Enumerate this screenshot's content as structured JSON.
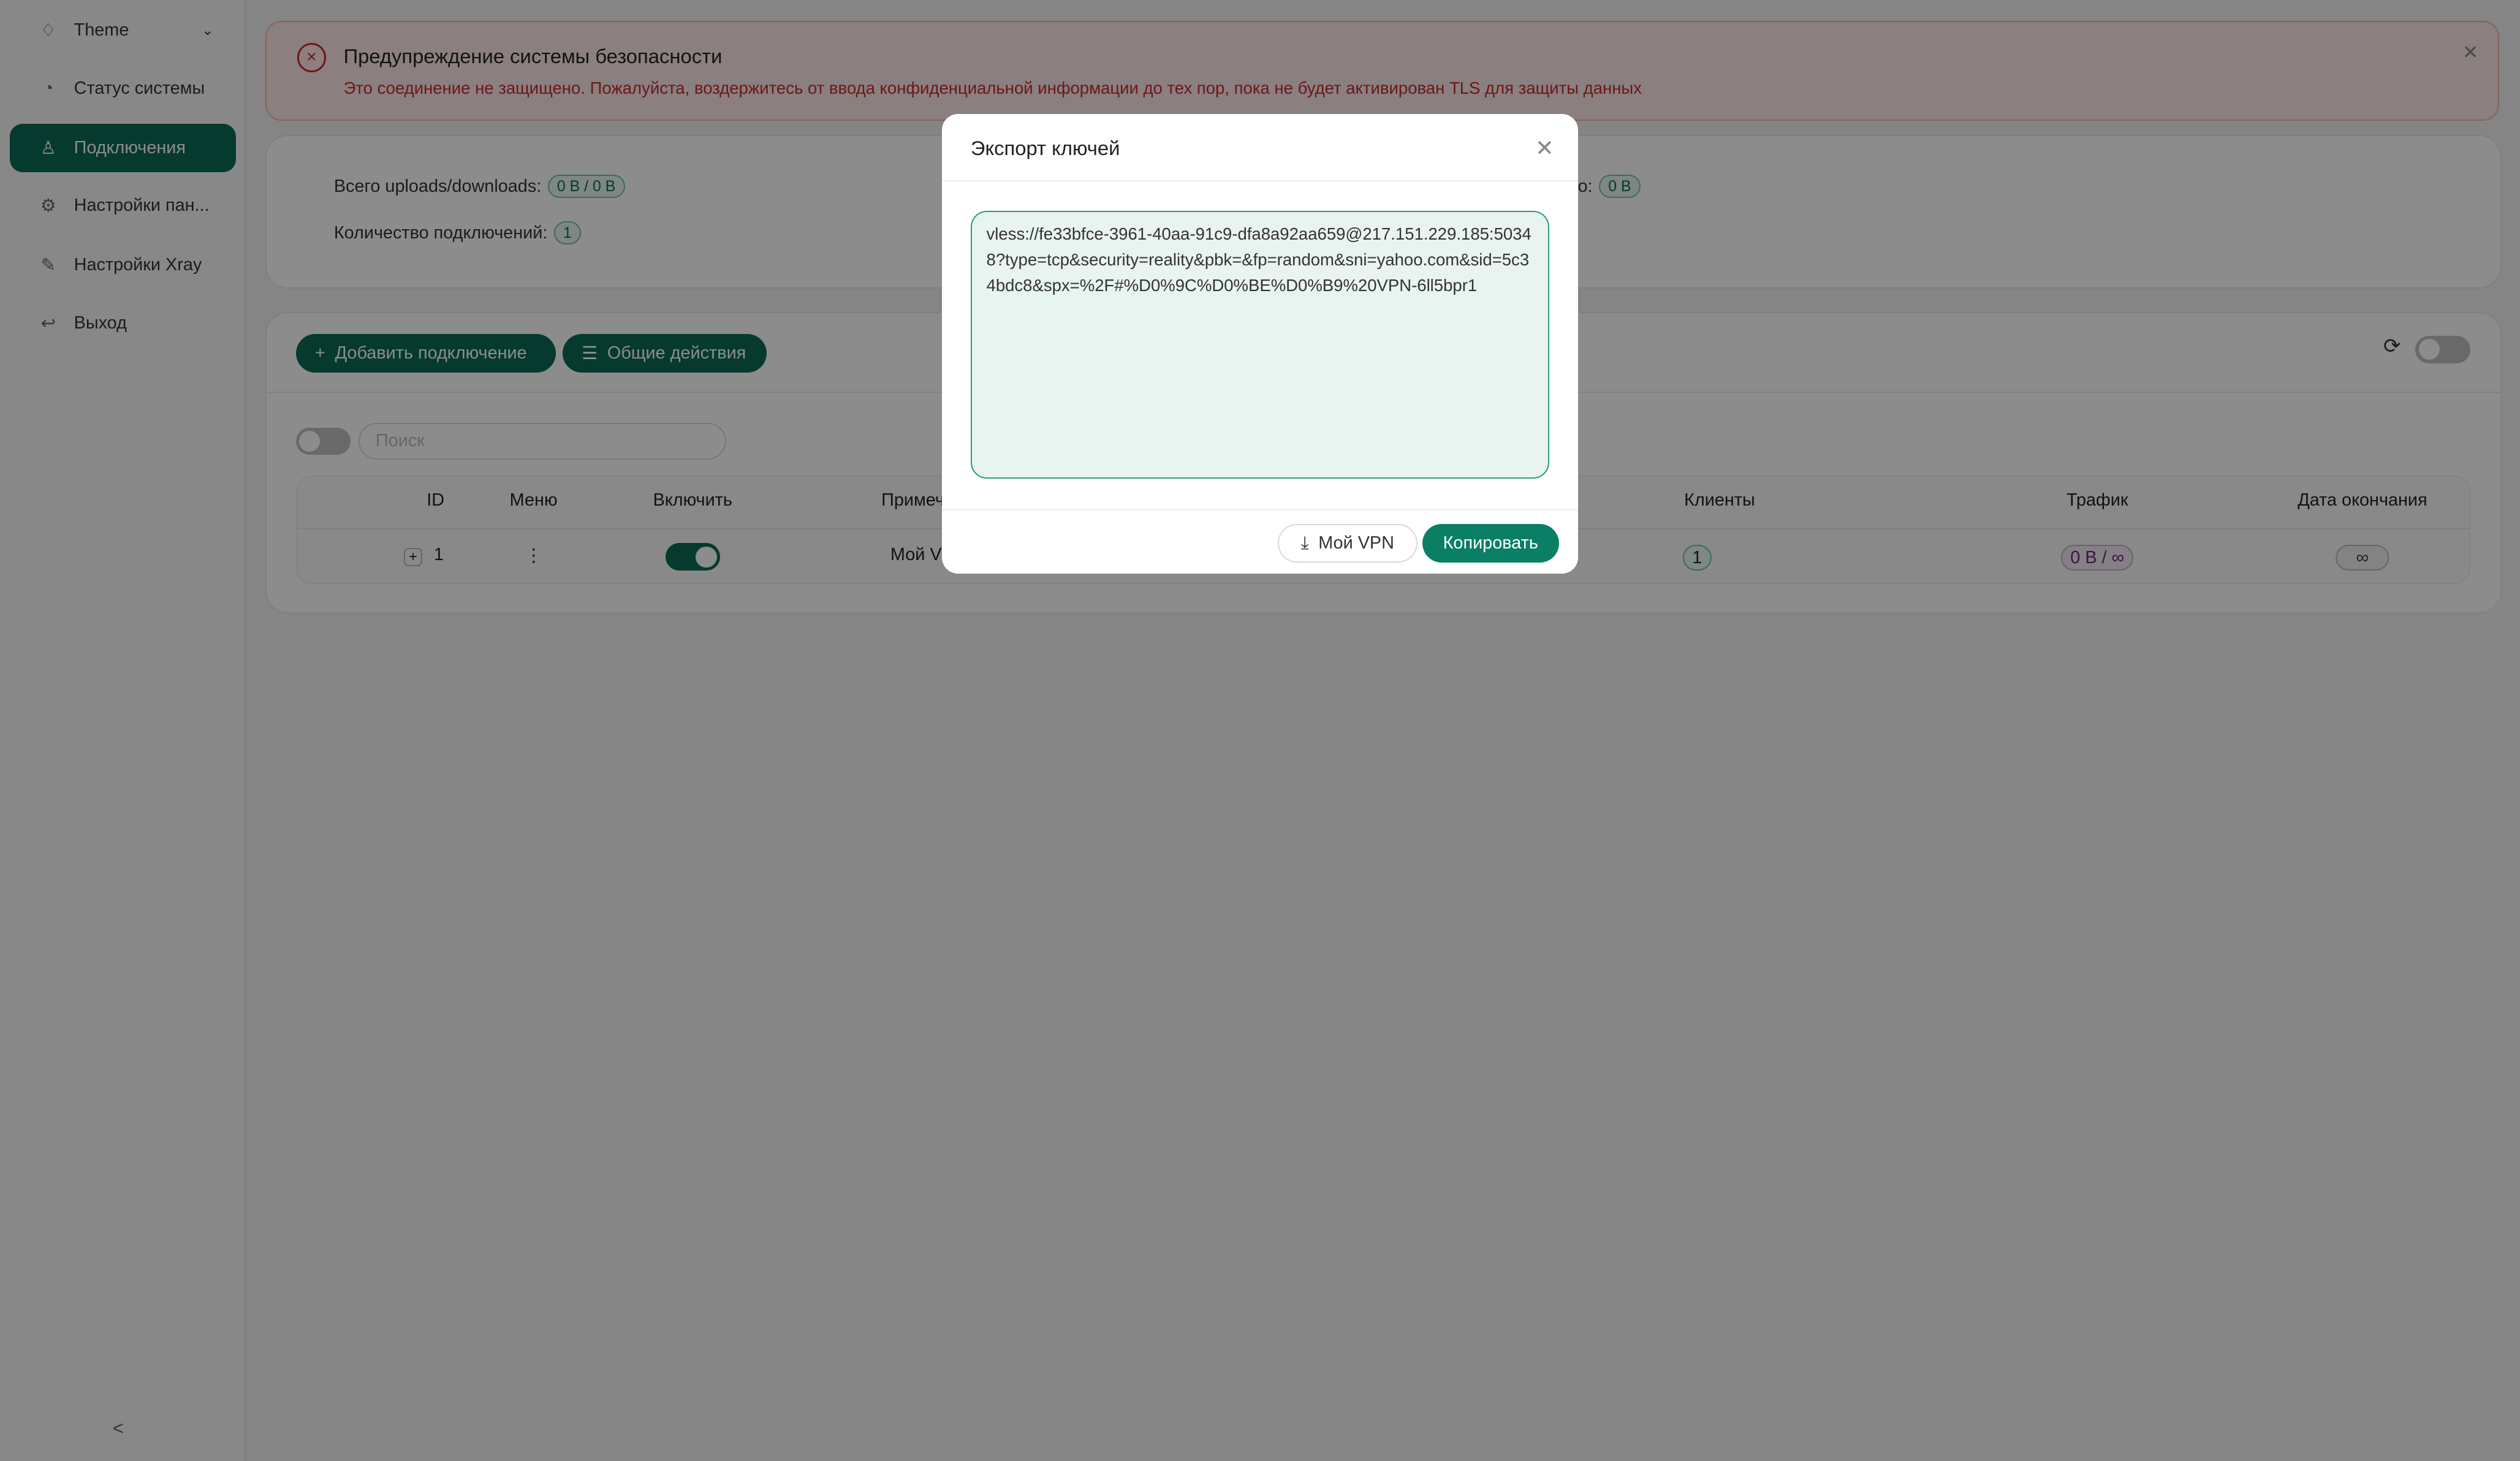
{
  "sidebar": {
    "items": [
      {
        "label": "Theme",
        "icon": "bulb-icon"
      },
      {
        "label": "Статус системы",
        "icon": "dashboard-icon"
      },
      {
        "label": "Подключения",
        "icon": "user-icon",
        "active": true
      },
      {
        "label": "Настройки пан...",
        "icon": "gear-icon"
      },
      {
        "label": "Настройки Xray",
        "icon": "tool-icon"
      },
      {
        "label": "Выход",
        "icon": "logout-icon"
      }
    ]
  },
  "alert": {
    "title": "Предупреждение системы безопасности",
    "description": "Это соединение не защищено. Пожалуйста, воздержитесь от ввода конфиденциальной информации до тех пор, пока не будет активирован TLS для защиты данных"
  },
  "stats": {
    "total_label": "Всего uploads/downloads:",
    "total_value": "0 B / 0 B",
    "count_label": "Количество подключений:",
    "count_value": "1",
    "right_label_fragment": "о:",
    "right_value": "0 B"
  },
  "toolbar": {
    "add_label": "Добавить подключение",
    "actions_label": "Общие действия",
    "search_placeholder": "Поиск"
  },
  "table": {
    "headers": [
      "ID",
      "Меню",
      "Включить",
      "Примеч",
      "Клиенты",
      "Трафик",
      "Дата окончания"
    ],
    "rows": [
      {
        "id": "1",
        "remark": "Мой V",
        "enabled": true,
        "clients": "1",
        "traffic": "0 B / ∞",
        "expiry": "∞"
      }
    ]
  },
  "modal": {
    "title": "Экспорт ключей",
    "link": "vless://fe33bfce-3961-40aa-91c9-dfa8a92aa659@217.151.229.185:50348?type=tcp&security=reality&pbk=&fp=random&sni=yahoo.com&sid=5c34bdc8&spx=%2F#%D0%9C%D0%BE%D0%B9%20VPN-6ll5bpr1",
    "download_label": "Мой VPN",
    "copy_label": "Копировать"
  },
  "colors": {
    "primary": "#0b6b57",
    "danger": "#d0252e"
  }
}
